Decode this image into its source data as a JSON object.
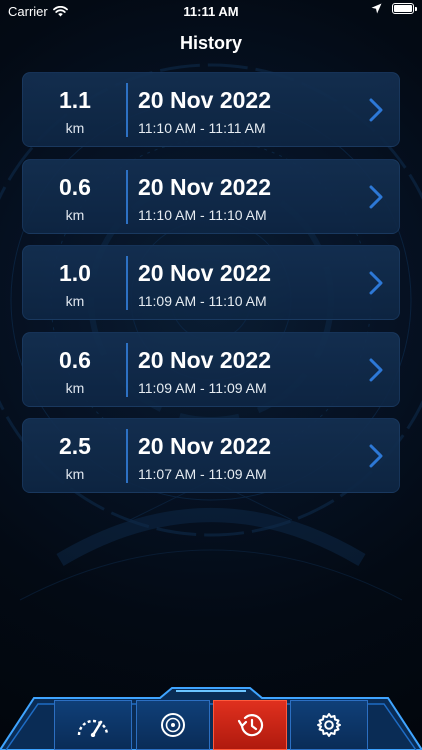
{
  "status_bar": {
    "carrier": "Carrier",
    "time": "11:11 AM",
    "icons": [
      "wifi-icon",
      "location-arrow-icon",
      "battery-icon"
    ]
  },
  "header": {
    "title": "History"
  },
  "history": [
    {
      "distance": "1.1",
      "unit": "km",
      "date": "20 Nov 2022",
      "time_range": "11:10 AM - 11:11 AM"
    },
    {
      "distance": "0.6",
      "unit": "km",
      "date": "20 Nov 2022",
      "time_range": "11:10 AM - 11:10 AM"
    },
    {
      "distance": "1.0",
      "unit": "km",
      "date": "20 Nov 2022",
      "time_range": "11:09 AM - 11:10 AM"
    },
    {
      "distance": "0.6",
      "unit": "km",
      "date": "20 Nov 2022",
      "time_range": "11:09 AM - 11:09 AM"
    },
    {
      "distance": "2.5",
      "unit": "km",
      "date": "20 Nov 2022",
      "time_range": "11:07 AM - 11:09 AM"
    }
  ],
  "tab_bar": {
    "tabs": [
      {
        "icon": "speedometer-icon",
        "active": false
      },
      {
        "icon": "disc-icon",
        "active": false
      },
      {
        "icon": "history-icon",
        "active": true
      },
      {
        "icon": "settings-gear-icon",
        "active": false
      }
    ]
  },
  "colors": {
    "background": "#02060c",
    "card": "#143052",
    "accent_blue": "#2d71c4",
    "active_tab": "#d52a1a",
    "text": "#ffffff"
  }
}
